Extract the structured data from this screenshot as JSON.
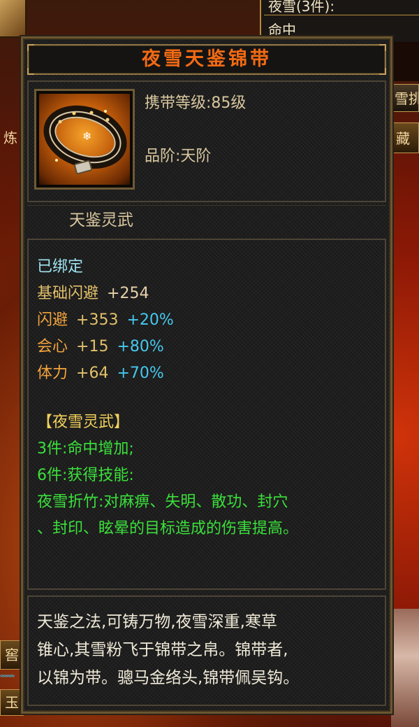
{
  "background": {
    "right_panel_row1": "夜雪(3件):",
    "right_panel_row2": "命中",
    "right_tab_1": "雪挑",
    "right_tab_2": "藏",
    "left_tab_1": "炼",
    "left_tab_2": "窖",
    "left_tab_3": "玉"
  },
  "tooltip": {
    "title": "夜雪天鉴锦带",
    "title_color": "#f26a14",
    "icon": "belt-icon",
    "level_line": "携带等级:85级",
    "grade_line": "品阶:天阶",
    "subtitle": "天鉴灵武",
    "bound_status": "已绑定",
    "stats": [
      {
        "name": "基础闪避",
        "base": "+254",
        "bonus": ""
      },
      {
        "name": "闪避",
        "base": "+353",
        "bonus": "+20%"
      },
      {
        "name": "会心",
        "base": "+15",
        "bonus": "+80%"
      },
      {
        "name": "体力",
        "base": "+64",
        "bonus": "+70%"
      }
    ],
    "set": {
      "name": "【夜雪灵武】",
      "effects": [
        "3件:命中增加;",
        "6件:获得技能:",
        "夜雪折竹:对麻痹、失明、散功、封穴",
        "、封印、眩晕的目标造成的伤害提高。"
      ]
    },
    "description": [
      "天鉴之法,可铸万物,夜雪深重,寒草",
      "锥心,其雪粉飞于锦带之帛。锦带者,",
      "以锦为带。骢马金络头,锦带佩吴钩。"
    ],
    "colors": {
      "bound": "#9fe4f2",
      "stat_name": "#e3c06b",
      "stat_value": "#f3a43c",
      "stat_bonus": "#46c8ee",
      "set_name": "#f2d25a",
      "set_effect": "#3be03b",
      "description": "#f0ead8"
    }
  }
}
